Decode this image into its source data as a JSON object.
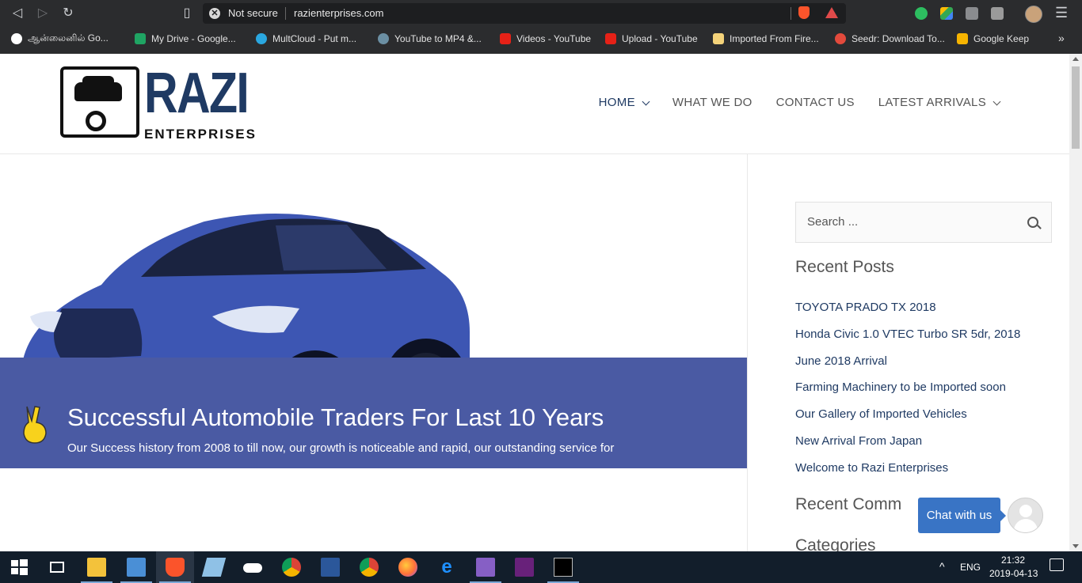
{
  "browser": {
    "security_label": "Not secure",
    "url": "razienterprises.com",
    "bookmarks": [
      {
        "label": "ஆன்லைனில் Go...",
        "icon": "google-icon",
        "color": "#4285f4"
      },
      {
        "label": "My Drive - Google...",
        "icon": "drive-icon",
        "color": "#1fa463"
      },
      {
        "label": "MultCloud - Put m...",
        "icon": "cloud-icon",
        "color": "#2aa7e0"
      },
      {
        "label": "YouTube to MP4 &...",
        "icon": "converter-icon",
        "color": "#6b8fa3"
      },
      {
        "label": "Videos - YouTube",
        "icon": "youtube-icon",
        "color": "#e62117"
      },
      {
        "label": "Upload - YouTube",
        "icon": "youtube-icon",
        "color": "#e62117"
      },
      {
        "label": "Imported From Fire...",
        "icon": "folder-icon",
        "color": "#f4d37a"
      },
      {
        "label": "Seedr: Download To...",
        "icon": "seedr-icon",
        "color": "#e34a3c"
      },
      {
        "label": "Google Keep",
        "icon": "keep-icon",
        "color": "#f6b400"
      }
    ]
  },
  "site": {
    "logo_title": "RAZI",
    "logo_subtitle": "ENTERPRISES",
    "nav": [
      "HOME",
      "WHAT WE DO",
      "CONTACT US",
      "LATEST ARRIVALS"
    ],
    "banner_heading": "Successful Automobile Traders For Last 10 Years",
    "banner_text": "Our Success history from 2008 to till now, our growth is noticeable and rapid, our outstanding service for",
    "search_placeholder": "Search ...",
    "recent_posts_heading": "Recent Posts",
    "recent_posts": [
      "TOYOTA PRADO TX 2018",
      "Honda Civic 1.0 VTEC Turbo SR 5dr, 2018",
      "June 2018 Arrival",
      "Farming Machinery to be Imported soon",
      "Our Gallery of Imported Vehicles",
      "New Arrival From Japan",
      "Welcome to Razi Enterprises"
    ],
    "recent_comments_heading": "Recent Comm",
    "categories_heading": "Categories",
    "chat_label": "Chat with us",
    "accent_color": "#1f3a63",
    "banner_color": "#4a5aa3"
  },
  "taskbar": {
    "lang": "ENG",
    "time": "21:32",
    "date": "2019-04-13"
  }
}
